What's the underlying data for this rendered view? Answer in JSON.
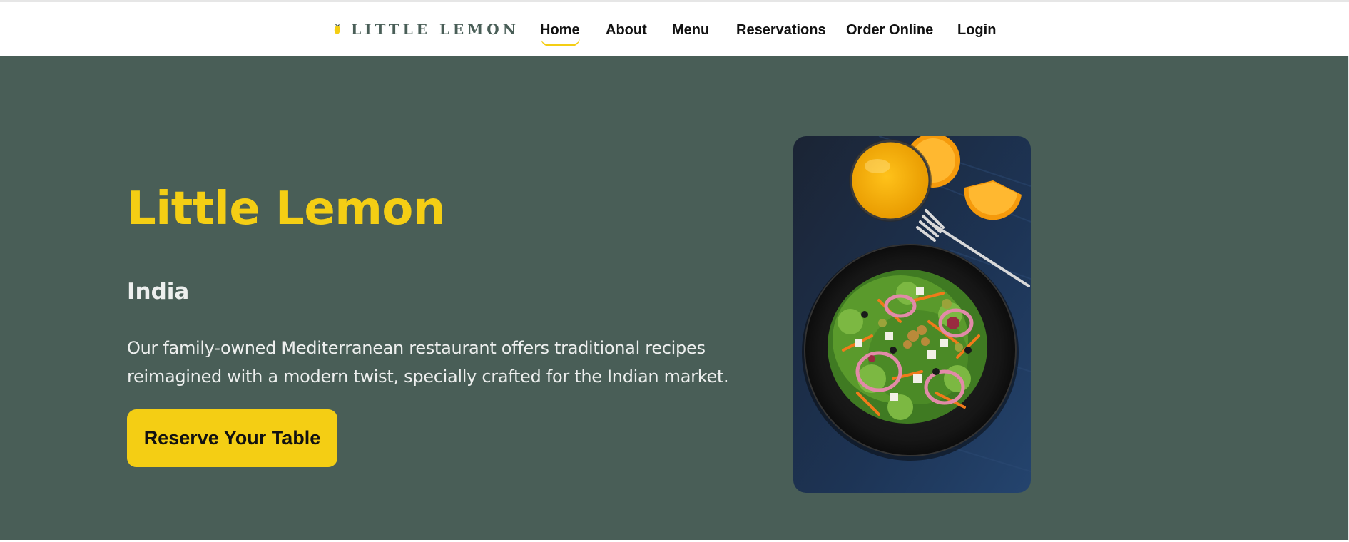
{
  "brand": {
    "logo_text": "LITTLE LEMON",
    "logo_icon": "lemon-icon"
  },
  "nav": {
    "items": [
      {
        "label": "Home",
        "active": true
      },
      {
        "label": "About",
        "active": false
      },
      {
        "label": "Menu",
        "active": false
      },
      {
        "label": "Reservations",
        "active": false
      },
      {
        "label": "Order Online",
        "active": false
      },
      {
        "label": "Login",
        "active": false
      }
    ]
  },
  "hero": {
    "title": "Little Lemon",
    "subtitle": "India",
    "description": "Our family-owned Mediterranean restaurant offers traditional recipes reimagined with a modern twist, specially crafted for the Indian market.",
    "cta_label": "Reserve Your Table",
    "image_subject": "salad-with-orange-juice-photo"
  },
  "colors": {
    "primary_green": "#495e57",
    "primary_yellow": "#f4ce14",
    "text_light": "#edefee",
    "text_dark": "#111111"
  }
}
